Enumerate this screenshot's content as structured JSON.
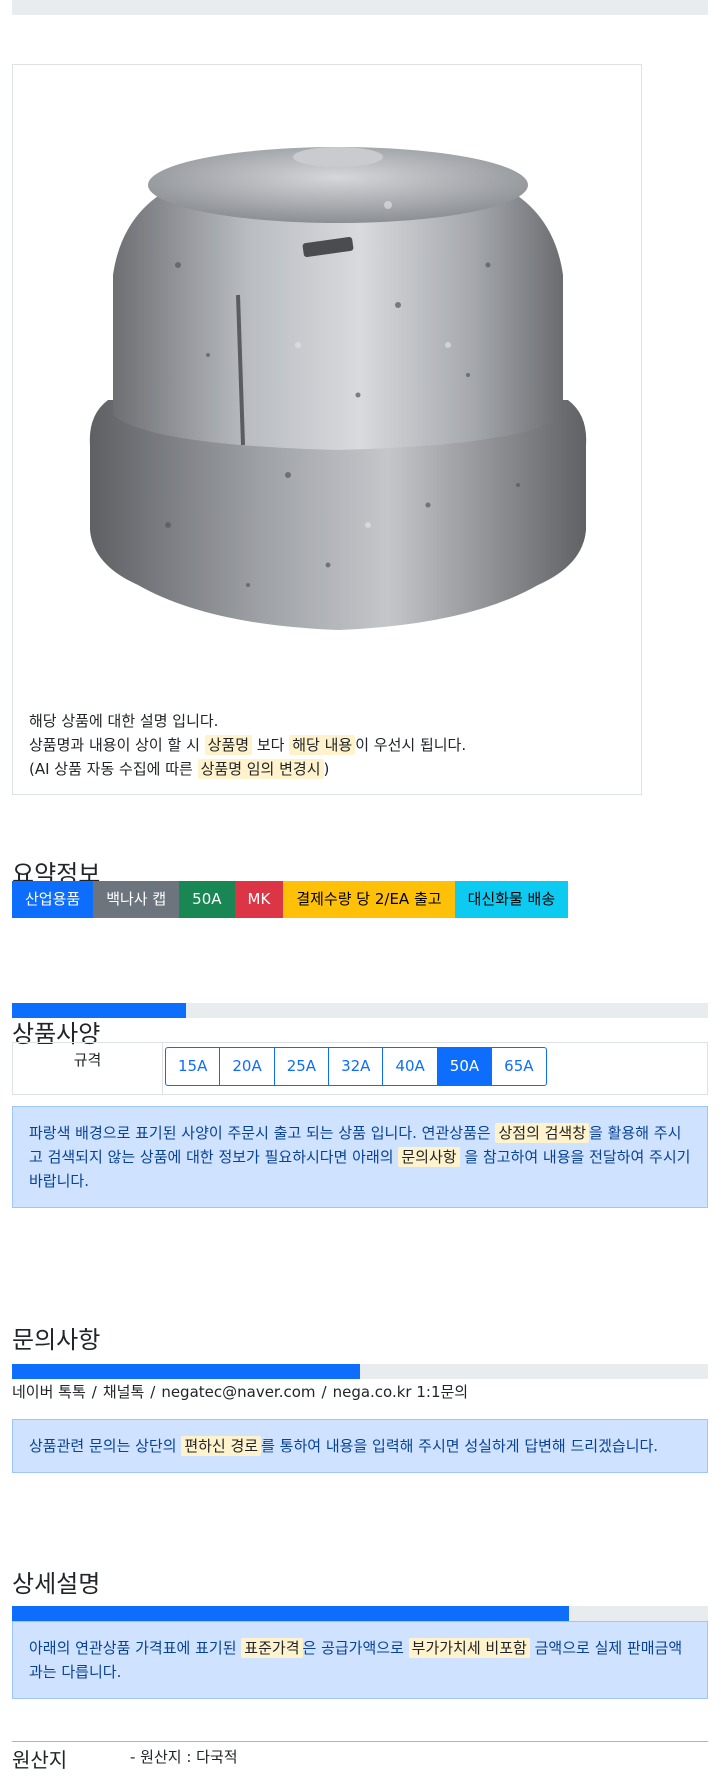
{
  "product": {
    "image_alt": "백나사 캡 50A",
    "description": {
      "line1": "해당 상품에 대한 설명 입니다.",
      "line2_a": "상품명과 내용이 상이 할 시",
      "line2_mark1": "상품명",
      "line2_b": "보다",
      "line2_mark2": "해당 내용",
      "line2_c": "이 우선시 됩니다.",
      "line3_a": "(AI 상품 자동 수집에 따른",
      "line3_mark": "상품명 임의 변경시",
      "line3_b": ")"
    }
  },
  "summary": {
    "title": "요약정보",
    "tags": [
      {
        "label": "산업용품",
        "bg": "#0d6efd",
        "fg": "#ffffff"
      },
      {
        "label": "백나사 캡",
        "bg": "#6c757d",
        "fg": "#ffffff"
      },
      {
        "label": "50A",
        "bg": "#198754",
        "fg": "#ffffff"
      },
      {
        "label": "MK",
        "bg": "#dc3545",
        "fg": "#ffffff"
      },
      {
        "label": "결제수량 당 2/EA 출고",
        "bg": "#ffc107",
        "fg": "#000000"
      },
      {
        "label": "대신화물 배송",
        "bg": "#0dcaf0",
        "fg": "#000000"
      }
    ]
  },
  "spec": {
    "title": "상품사양",
    "progress": 25,
    "label": "규격",
    "options": [
      "15A",
      "20A",
      "25A",
      "32A",
      "40A",
      "50A",
      "65A"
    ],
    "selected": "50A",
    "notice": {
      "a": "파랑색 배경으로 표기된 사양이 주문시 출고 되는 상품 입니다. 연관상품은",
      "mark1": "상점의 검색창",
      "b": "을 활용해 주시고 검색되지 않는 상품에 대한 정보가 필요하시다면 아래의",
      "mark2": "문의사항",
      "c": "을 참고하여 내용을 전달하여 주시기 바랍니다."
    }
  },
  "inquiry": {
    "title": "문의사항",
    "progress": 50,
    "contacts": [
      "네이버 톡톡",
      "채널톡",
      "negatec@naver.com",
      "nega.co.kr 1:1문의"
    ],
    "notice": {
      "a": "상품관련 문의는 상단의",
      "mark": "편하신 경로",
      "b": "를 통하여 내용을 입력해 주시면 성실하게 답변해 드리겠습니다."
    }
  },
  "detail": {
    "title": "상세설명",
    "progress": 80,
    "notice": {
      "a": "아래의 연관상품 가격표에 표기된",
      "mark1": "표준가격",
      "b": "은 공급가액으로",
      "mark2": "부가가치세 비포함",
      "c": "금액으로 실제 판매금액과는 다릅니다."
    }
  },
  "origin": {
    "title": "원산지",
    "text": "- 원산지 : 다국적"
  }
}
